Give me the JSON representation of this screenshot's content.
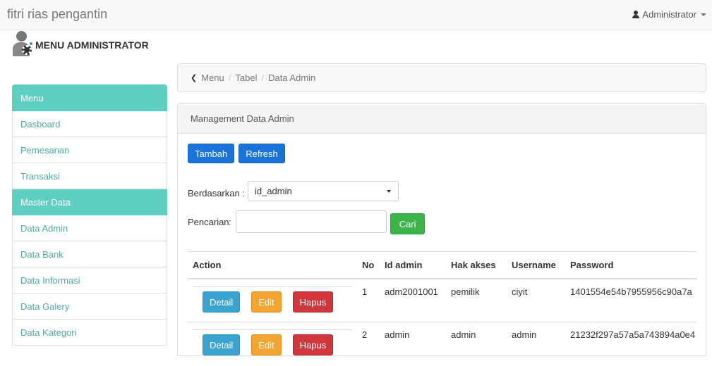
{
  "app": {
    "brand": "fitri rias pengantin",
    "user": "Administrator"
  },
  "sidebar": {
    "title": "MENU ADMINISTRATOR",
    "items": [
      {
        "label": "Menu"
      },
      {
        "label": "Dasboard"
      },
      {
        "label": "Pemesanan"
      },
      {
        "label": "Transaksi"
      },
      {
        "label": "Master Data"
      },
      {
        "label": "Data Admin"
      },
      {
        "label": "Data Bank"
      },
      {
        "label": "Data Informasi"
      },
      {
        "label": "Data Galery"
      },
      {
        "label": "Data Kategori"
      }
    ]
  },
  "breadcrumb": {
    "items": [
      "Menu",
      "Tabel",
      "Data Admin"
    ]
  },
  "panel": {
    "title": "Management Data Admin",
    "buttons": {
      "add": "Tambah",
      "refresh": "Refresh"
    },
    "filter": {
      "label": "Berdasarkan :",
      "selected": "id_admin"
    },
    "search": {
      "label": "Pencarian",
      "colon": ":",
      "value": "",
      "button": "Cari"
    }
  },
  "table": {
    "headers": [
      "Action",
      "No",
      "Id admin",
      "Hak akses",
      "Username",
      "Password"
    ],
    "action_labels": {
      "detail": "Detail",
      "edit": "Edit",
      "delete": "Hapus"
    },
    "rows": [
      {
        "no": "1",
        "id": "adm2001001",
        "hak": "pemilik",
        "user": "ciyit",
        "pass": "1401554e54b7955956c90a7a"
      },
      {
        "no": "2",
        "id": "admin",
        "hak": "admin",
        "user": "admin",
        "pass": "21232f297a57a5a743894a0e4"
      }
    ]
  },
  "colors": {
    "accent": "#5fcfc1",
    "primary": "#1a73d9",
    "success": "#3bb54a",
    "info": "#3aa3d0",
    "warning": "#f3a433",
    "danger": "#d0363b"
  }
}
